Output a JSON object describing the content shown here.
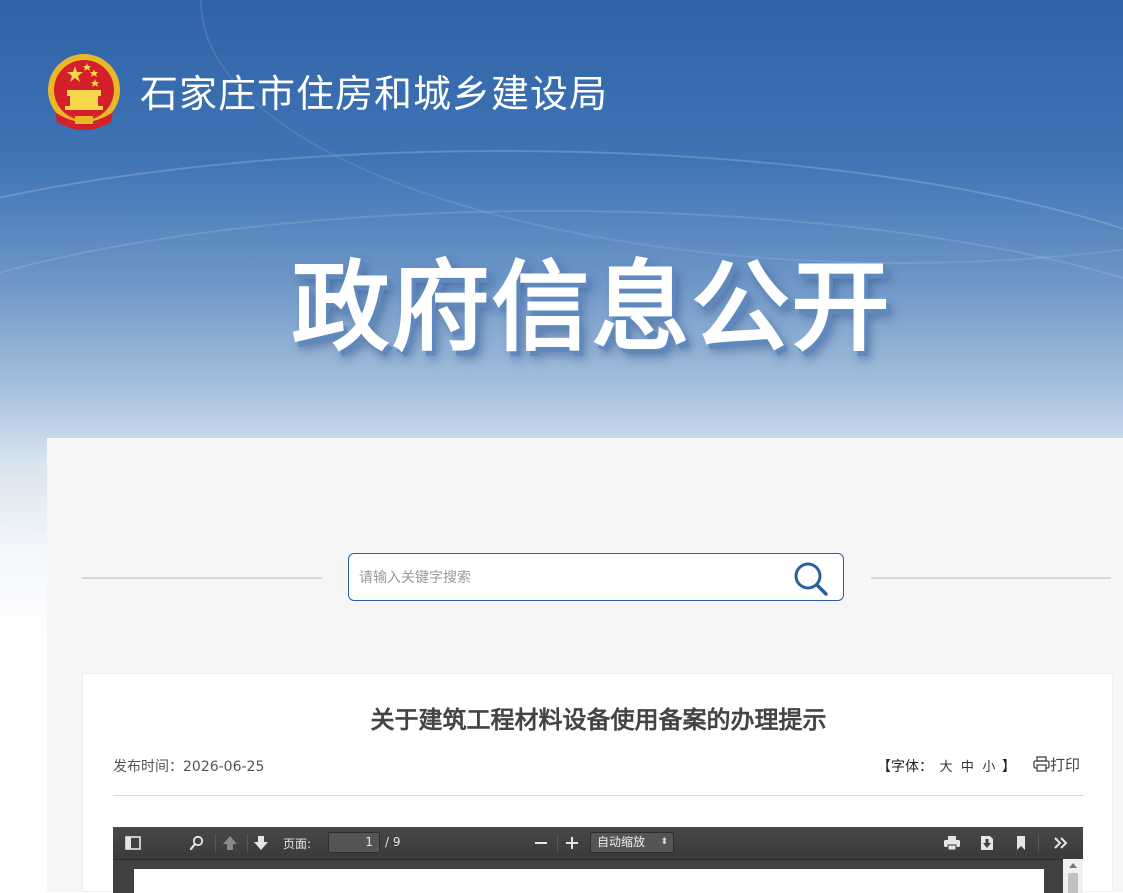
{
  "header": {
    "site_title": "石家庄市住房和城乡建设局",
    "hero_title": "政府信息公开"
  },
  "search": {
    "placeholder": "请输入关键字搜索"
  },
  "article": {
    "title": "关于建筑工程材料设备使用备案的办理提示",
    "date_label": "发布时间：",
    "date_value": "2026-06-25",
    "font_bracket_open": "【",
    "font_label": "字体：",
    "font_large": "大",
    "font_medium": "中",
    "font_small": "小",
    "font_bracket_close": "】",
    "print_label": "打印"
  },
  "pdf_viewer": {
    "page_label": "页面:",
    "current_page": "1",
    "total_pages": "/ 9",
    "zoom_value": "自动缩放",
    "zoom_arrows": "⬍"
  },
  "colors": {
    "primary_blue": "#2d5fa0",
    "banner_top": "#2f63a6",
    "panel_bg": "#f6f6f6",
    "toolbar_bg": "#404040"
  }
}
